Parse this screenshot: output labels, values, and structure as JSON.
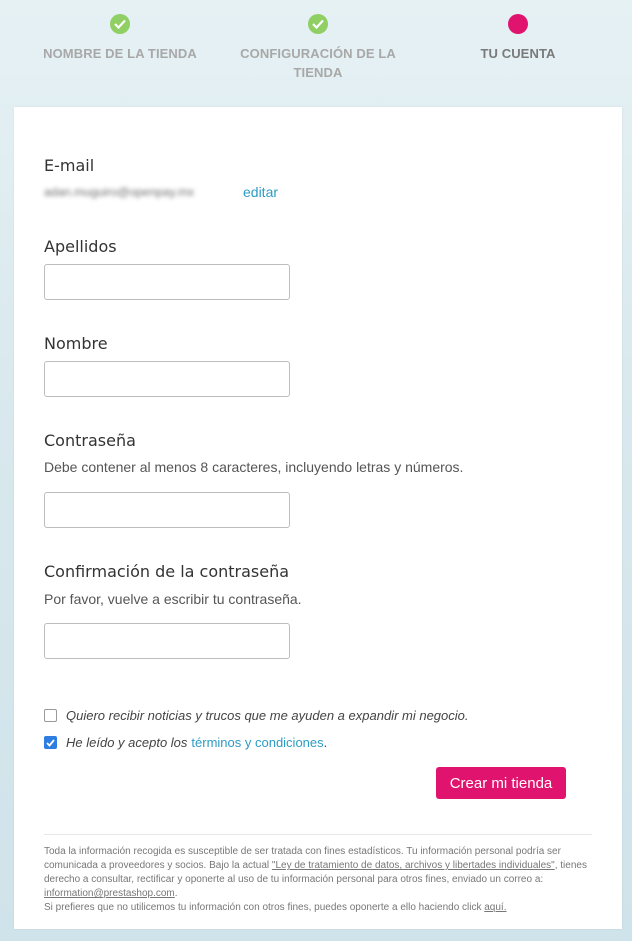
{
  "steps": [
    {
      "label": "NOMBRE DE LA TIENDA",
      "status": "done"
    },
    {
      "label": "CONFIGURACIÓN DE LA TIENDA",
      "status": "done"
    },
    {
      "label": "TU CUENTA",
      "status": "current"
    }
  ],
  "form": {
    "email_label": "E-mail",
    "email_value": "adan.muguiro@openpay.mx",
    "edit_link": "editar",
    "last_name_label": "Apellidos",
    "last_name_value": "",
    "first_name_label": "Nombre",
    "first_name_value": "",
    "password_label": "Contraseña",
    "password_help": "Debe contener al menos 8 caracteres, incluyendo letras y números.",
    "password_value": "",
    "confirm_label": "Confirmación de la contraseña",
    "confirm_help": "Por favor, vuelve a escribir tu contraseña.",
    "confirm_value": "",
    "newsletter_text": "Quiero recibir noticias y trucos que me ayuden a expandir mi negocio.",
    "newsletter_checked": false,
    "terms_text": "He leído y acepto los",
    "terms_link": "términos y condiciones",
    "terms_suffix": ".",
    "terms_checked": true,
    "submit_label": "Crear mi tienda"
  },
  "footer": {
    "line1": "Toda la información recogida es susceptible de ser tratada con fines estadísticos. Tu información personal podría ser comunicada a proveedores y socios. Bajo la actual ",
    "law_link": "\"Ley de tratamiento de datos, archivos y libertades individuales\"",
    "line2": ", tienes derecho a consultar, rectificar y oponerte al uso de tu información personal para otros fines, enviado un correo a: ",
    "email_link": "information@prestashop.com",
    "line3": ".",
    "line4": "Si prefieres que no utilicemos tu información con otros fines, puedes oponerte a ello haciendo click ",
    "here_link": "aquí."
  },
  "colors": {
    "accent": "#e0146e",
    "done": "#8fcf63",
    "link": "#2d9cc4",
    "checkbox": "#2f7de1"
  }
}
